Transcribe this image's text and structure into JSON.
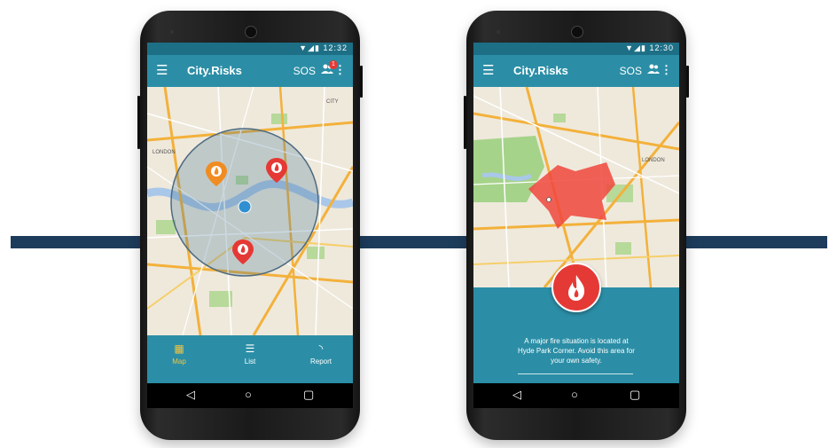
{
  "colors": {
    "primary": "#2b8ea6",
    "status_bar": "#1d6f86",
    "divider_bar": "#1d3c5b",
    "fire_red": "#e53935",
    "active_tab": "#f4c542"
  },
  "phone_left": {
    "status_time": "12:32",
    "app_bar": {
      "menu_icon": "hamburger-menu-icon",
      "title": "City.Risks",
      "sos_label": "SOS",
      "people_icon": "people-icon",
      "badge_count": "1",
      "overflow_icon": "more-vert-icon"
    },
    "map": {
      "labels": [
        "LONDON",
        "CITY"
      ],
      "markers": [
        "orange-fire-marker",
        "red-fire-marker",
        "red-fire-marker"
      ],
      "user_location": "blue-dot"
    },
    "bottom_nav": [
      {
        "label": "Map",
        "icon": "map-icon",
        "active": true
      },
      {
        "label": "List",
        "icon": "list-icon",
        "active": false
      },
      {
        "label": "Report",
        "icon": "rss-icon",
        "active": false
      }
    ]
  },
  "phone_right": {
    "status_time": "12:30",
    "app_bar": {
      "menu_icon": "hamburger-menu-icon",
      "title": "City.Risks",
      "sos_label": "SOS",
      "people_icon": "people-icon",
      "overflow_icon": "more-vert-icon"
    },
    "map": {
      "labels": [
        "LONDON"
      ],
      "risk_area": "red-fire-zone"
    },
    "alert": {
      "icon": "fire-icon",
      "text_line1": "A major fire situation is located at",
      "text_line2": "Hyde Park Corner. Avoid this area for",
      "text_line3": "your own safety."
    }
  },
  "system_nav": {
    "back_icon": "back-triangle-icon",
    "home_icon": "home-circle-icon",
    "recents_icon": "recents-square-icon"
  }
}
